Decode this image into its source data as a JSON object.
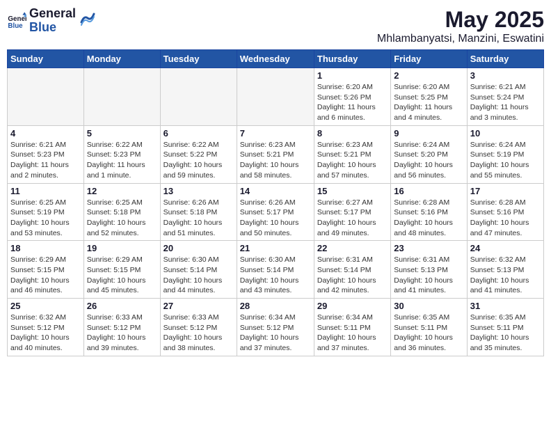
{
  "header": {
    "logo_general": "General",
    "logo_blue": "Blue",
    "month_title": "May 2025",
    "location": "Mhlambanyatsi, Manzini, Eswatini"
  },
  "weekdays": [
    "Sunday",
    "Monday",
    "Tuesday",
    "Wednesday",
    "Thursday",
    "Friday",
    "Saturday"
  ],
  "weeks": [
    [
      {
        "day": "",
        "info": "",
        "empty": true
      },
      {
        "day": "",
        "info": "",
        "empty": true
      },
      {
        "day": "",
        "info": "",
        "empty": true
      },
      {
        "day": "",
        "info": "",
        "empty": true
      },
      {
        "day": "1",
        "info": "Sunrise: 6:20 AM\nSunset: 5:26 PM\nDaylight: 11 hours\nand 6 minutes.",
        "empty": false
      },
      {
        "day": "2",
        "info": "Sunrise: 6:20 AM\nSunset: 5:25 PM\nDaylight: 11 hours\nand 4 minutes.",
        "empty": false
      },
      {
        "day": "3",
        "info": "Sunrise: 6:21 AM\nSunset: 5:24 PM\nDaylight: 11 hours\nand 3 minutes.",
        "empty": false
      }
    ],
    [
      {
        "day": "4",
        "info": "Sunrise: 6:21 AM\nSunset: 5:23 PM\nDaylight: 11 hours\nand 2 minutes.",
        "empty": false
      },
      {
        "day": "5",
        "info": "Sunrise: 6:22 AM\nSunset: 5:23 PM\nDaylight: 11 hours\nand 1 minute.",
        "empty": false
      },
      {
        "day": "6",
        "info": "Sunrise: 6:22 AM\nSunset: 5:22 PM\nDaylight: 10 hours\nand 59 minutes.",
        "empty": false
      },
      {
        "day": "7",
        "info": "Sunrise: 6:23 AM\nSunset: 5:21 PM\nDaylight: 10 hours\nand 58 minutes.",
        "empty": false
      },
      {
        "day": "8",
        "info": "Sunrise: 6:23 AM\nSunset: 5:21 PM\nDaylight: 10 hours\nand 57 minutes.",
        "empty": false
      },
      {
        "day": "9",
        "info": "Sunrise: 6:24 AM\nSunset: 5:20 PM\nDaylight: 10 hours\nand 56 minutes.",
        "empty": false
      },
      {
        "day": "10",
        "info": "Sunrise: 6:24 AM\nSunset: 5:19 PM\nDaylight: 10 hours\nand 55 minutes.",
        "empty": false
      }
    ],
    [
      {
        "day": "11",
        "info": "Sunrise: 6:25 AM\nSunset: 5:19 PM\nDaylight: 10 hours\nand 53 minutes.",
        "empty": false
      },
      {
        "day": "12",
        "info": "Sunrise: 6:25 AM\nSunset: 5:18 PM\nDaylight: 10 hours\nand 52 minutes.",
        "empty": false
      },
      {
        "day": "13",
        "info": "Sunrise: 6:26 AM\nSunset: 5:18 PM\nDaylight: 10 hours\nand 51 minutes.",
        "empty": false
      },
      {
        "day": "14",
        "info": "Sunrise: 6:26 AM\nSunset: 5:17 PM\nDaylight: 10 hours\nand 50 minutes.",
        "empty": false
      },
      {
        "day": "15",
        "info": "Sunrise: 6:27 AM\nSunset: 5:17 PM\nDaylight: 10 hours\nand 49 minutes.",
        "empty": false
      },
      {
        "day": "16",
        "info": "Sunrise: 6:28 AM\nSunset: 5:16 PM\nDaylight: 10 hours\nand 48 minutes.",
        "empty": false
      },
      {
        "day": "17",
        "info": "Sunrise: 6:28 AM\nSunset: 5:16 PM\nDaylight: 10 hours\nand 47 minutes.",
        "empty": false
      }
    ],
    [
      {
        "day": "18",
        "info": "Sunrise: 6:29 AM\nSunset: 5:15 PM\nDaylight: 10 hours\nand 46 minutes.",
        "empty": false
      },
      {
        "day": "19",
        "info": "Sunrise: 6:29 AM\nSunset: 5:15 PM\nDaylight: 10 hours\nand 45 minutes.",
        "empty": false
      },
      {
        "day": "20",
        "info": "Sunrise: 6:30 AM\nSunset: 5:14 PM\nDaylight: 10 hours\nand 44 minutes.",
        "empty": false
      },
      {
        "day": "21",
        "info": "Sunrise: 6:30 AM\nSunset: 5:14 PM\nDaylight: 10 hours\nand 43 minutes.",
        "empty": false
      },
      {
        "day": "22",
        "info": "Sunrise: 6:31 AM\nSunset: 5:14 PM\nDaylight: 10 hours\nand 42 minutes.",
        "empty": false
      },
      {
        "day": "23",
        "info": "Sunrise: 6:31 AM\nSunset: 5:13 PM\nDaylight: 10 hours\nand 41 minutes.",
        "empty": false
      },
      {
        "day": "24",
        "info": "Sunrise: 6:32 AM\nSunset: 5:13 PM\nDaylight: 10 hours\nand 41 minutes.",
        "empty": false
      }
    ],
    [
      {
        "day": "25",
        "info": "Sunrise: 6:32 AM\nSunset: 5:12 PM\nDaylight: 10 hours\nand 40 minutes.",
        "empty": false
      },
      {
        "day": "26",
        "info": "Sunrise: 6:33 AM\nSunset: 5:12 PM\nDaylight: 10 hours\nand 39 minutes.",
        "empty": false
      },
      {
        "day": "27",
        "info": "Sunrise: 6:33 AM\nSunset: 5:12 PM\nDaylight: 10 hours\nand 38 minutes.",
        "empty": false
      },
      {
        "day": "28",
        "info": "Sunrise: 6:34 AM\nSunset: 5:12 PM\nDaylight: 10 hours\nand 37 minutes.",
        "empty": false
      },
      {
        "day": "29",
        "info": "Sunrise: 6:34 AM\nSunset: 5:11 PM\nDaylight: 10 hours\nand 37 minutes.",
        "empty": false
      },
      {
        "day": "30",
        "info": "Sunrise: 6:35 AM\nSunset: 5:11 PM\nDaylight: 10 hours\nand 36 minutes.",
        "empty": false
      },
      {
        "day": "31",
        "info": "Sunrise: 6:35 AM\nSunset: 5:11 PM\nDaylight: 10 hours\nand 35 minutes.",
        "empty": false
      }
    ]
  ]
}
